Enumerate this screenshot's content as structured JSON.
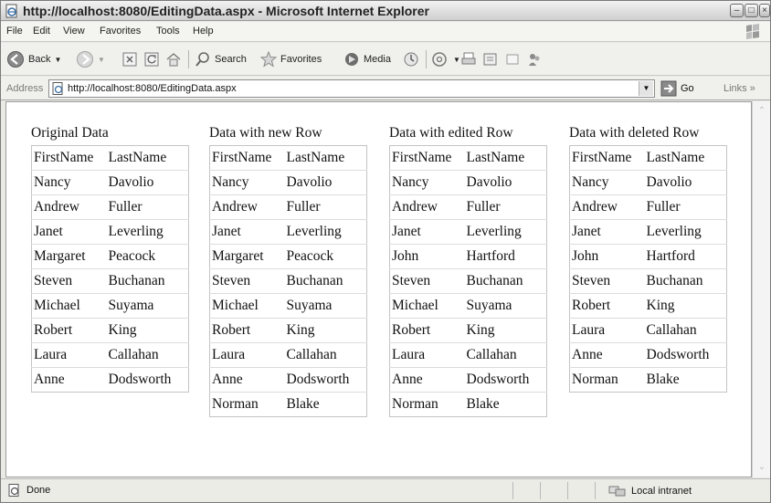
{
  "window": {
    "title": "http://localhost:8080/EditingData.aspx - Microsoft Internet Explorer"
  },
  "menu": [
    "File",
    "Edit",
    "View",
    "Favorites",
    "Tools",
    "Help"
  ],
  "toolbar": {
    "back_label": "Back",
    "search_label": "Search",
    "favorites_label": "Favorites",
    "media_label": "Media"
  },
  "address": {
    "label": "Address",
    "url": "http://localhost:8080/EditingData.aspx",
    "go_label": "Go",
    "links_label": "Links"
  },
  "grids": [
    {
      "title": "Original Data",
      "header": [
        "FirstName",
        "LastName"
      ],
      "rows": [
        [
          "Nancy",
          "Davolio"
        ],
        [
          "Andrew",
          "Fuller"
        ],
        [
          "Janet",
          "Leverling"
        ],
        [
          "Margaret",
          "Peacock"
        ],
        [
          "Steven",
          "Buchanan"
        ],
        [
          "Michael",
          "Suyama"
        ],
        [
          "Robert",
          "King"
        ],
        [
          "Laura",
          "Callahan"
        ],
        [
          "Anne",
          "Dodsworth"
        ]
      ]
    },
    {
      "title": "Data with new Row",
      "header": [
        "FirstName",
        "LastName"
      ],
      "rows": [
        [
          "Nancy",
          "Davolio"
        ],
        [
          "Andrew",
          "Fuller"
        ],
        [
          "Janet",
          "Leverling"
        ],
        [
          "Margaret",
          "Peacock"
        ],
        [
          "Steven",
          "Buchanan"
        ],
        [
          "Michael",
          "Suyama"
        ],
        [
          "Robert",
          "King"
        ],
        [
          "Laura",
          "Callahan"
        ],
        [
          "Anne",
          "Dodsworth"
        ],
        [
          "Norman",
          "Blake"
        ]
      ]
    },
    {
      "title": "Data with edited Row",
      "header": [
        "FirstName",
        "LastName"
      ],
      "rows": [
        [
          "Nancy",
          "Davolio"
        ],
        [
          "Andrew",
          "Fuller"
        ],
        [
          "Janet",
          "Leverling"
        ],
        [
          "John",
          "Hartford"
        ],
        [
          "Steven",
          "Buchanan"
        ],
        [
          "Michael",
          "Suyama"
        ],
        [
          "Robert",
          "King"
        ],
        [
          "Laura",
          "Callahan"
        ],
        [
          "Anne",
          "Dodsworth"
        ],
        [
          "Norman",
          "Blake"
        ]
      ]
    },
    {
      "title": "Data with deleted Row",
      "header": [
        "FirstName",
        "LastName"
      ],
      "rows": [
        [
          "Nancy",
          "Davolio"
        ],
        [
          "Andrew",
          "Fuller"
        ],
        [
          "Janet",
          "Leverling"
        ],
        [
          "John",
          "Hartford"
        ],
        [
          "Steven",
          "Buchanan"
        ],
        [
          "Robert",
          "King"
        ],
        [
          "Laura",
          "Callahan"
        ],
        [
          "Anne",
          "Dodsworth"
        ],
        [
          "Norman",
          "Blake"
        ]
      ]
    }
  ],
  "status": {
    "text": "Done",
    "zone": "Local intranet"
  },
  "icons": {
    "ie_page": "ie-page-icon",
    "back": "back-arrow-icon",
    "forward": "forward-arrow-icon",
    "stop": "stop-icon",
    "refresh": "refresh-icon",
    "home": "home-icon",
    "search": "search-icon",
    "favorites": "favorites-star-icon",
    "media": "media-icon",
    "history": "history-icon",
    "mail": "mail-icon",
    "print": "print-icon",
    "edit": "edit-icon",
    "discuss": "discuss-icon",
    "messenger": "messenger-icon",
    "go": "go-arrow-icon",
    "zone": "local-intranet-icon"
  }
}
